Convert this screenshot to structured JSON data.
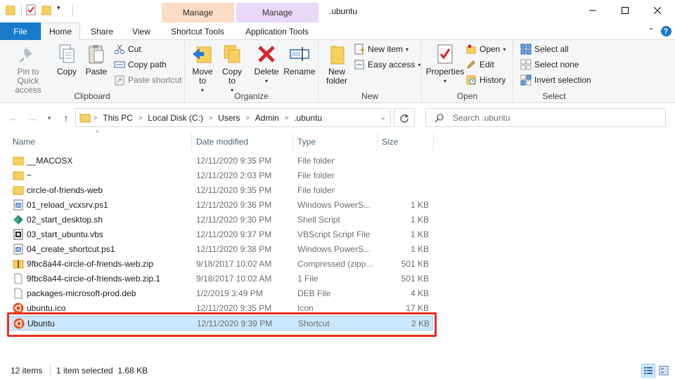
{
  "window": {
    "title": ".ubuntu",
    "contextual_tabs": [
      "Manage",
      "Manage"
    ]
  },
  "tabs": [
    "File",
    "Home",
    "Share",
    "View",
    "Shortcut Tools",
    "Application Tools"
  ],
  "ribbon": {
    "clipboard": {
      "label": "Clipboard",
      "pin": "Pin to Quick access",
      "copy": "Copy",
      "paste": "Paste",
      "cut": "Cut",
      "copy_path": "Copy path",
      "paste_shortcut": "Paste shortcut"
    },
    "organize": {
      "label": "Organize",
      "move_to": "Move to",
      "copy_to": "Copy to",
      "delete": "Delete",
      "rename": "Rename"
    },
    "new": {
      "label": "New",
      "new_folder": "New folder",
      "new_item": "New item",
      "easy_access": "Easy access"
    },
    "open": {
      "label": "Open",
      "properties": "Properties",
      "open": "Open",
      "edit": "Edit",
      "history": "History"
    },
    "select": {
      "label": "Select",
      "select_all": "Select all",
      "select_none": "Select none",
      "invert": "Invert selection"
    }
  },
  "address": {
    "breadcrumbs": [
      "This PC",
      "Local Disk (C:)",
      "Users",
      "Admin",
      ".ubuntu"
    ],
    "search_placeholder": "Search .ubuntu"
  },
  "columns": [
    "Name",
    "Date modified",
    "Type",
    "Size"
  ],
  "files": [
    {
      "name": "__MACOSX",
      "date": "12/11/2020 9:35 PM",
      "type": "File folder",
      "size": "",
      "icon": "folder-icon"
    },
    {
      "name": "~",
      "date": "12/11/2020 2:03 PM",
      "type": "File folder",
      "size": "",
      "icon": "folder-icon"
    },
    {
      "name": "circle-of-friends-web",
      "date": "12/11/2020 9:35 PM",
      "type": "File folder",
      "size": "",
      "icon": "folder-icon"
    },
    {
      "name": "01_reload_vcxsrv.ps1",
      "date": "12/11/2020 9:36 PM",
      "type": "Windows PowerS...",
      "size": "1 KB",
      "icon": "script-icon"
    },
    {
      "name": "02_start_desktop.sh",
      "date": "12/11/2020 9:30 PM",
      "type": "Shell Script",
      "size": "1 KB",
      "icon": "shell-icon"
    },
    {
      "name": "03_start_ubuntu.vbs",
      "date": "12/11/2020 9:37 PM",
      "type": "VBScript Script File",
      "size": "1 KB",
      "icon": "vbs-icon"
    },
    {
      "name": "04_create_shortcut.ps1",
      "date": "12/11/2020 9:38 PM",
      "type": "Windows PowerS...",
      "size": "1 KB",
      "icon": "script-icon"
    },
    {
      "name": "9fbc8a44-circle-of-friends-web.zip",
      "date": "9/18/2017 10:02 AM",
      "type": "Compressed (zipp...",
      "size": "501 KB",
      "icon": "zip-icon"
    },
    {
      "name": "9fbc8a44-circle-of-friends-web.zip.1",
      "date": "9/18/2017 10:02 AM",
      "type": "1 File",
      "size": "501 KB",
      "icon": "file-icon"
    },
    {
      "name": "packages-microsoft-prod.deb",
      "date": "1/2/2019 3:49 PM",
      "type": "DEB File",
      "size": "4 KB",
      "icon": "file-icon"
    },
    {
      "name": "ubuntu.ico",
      "date": "12/11/2020 9:35 PM",
      "type": "Icon",
      "size": "17 KB",
      "icon": "ubuntu-icon"
    },
    {
      "name": "Ubuntu",
      "date": "12/11/2020 9:39 PM",
      "type": "Shortcut",
      "size": "2 KB",
      "icon": "ubuntu-icon",
      "selected": true
    }
  ],
  "status": {
    "count": "12 items",
    "selection": "1 item selected  1.68 KB"
  },
  "colors": {
    "accent": "#1979ca",
    "selection": "#cce8ff",
    "highlight": "#e8321e"
  }
}
